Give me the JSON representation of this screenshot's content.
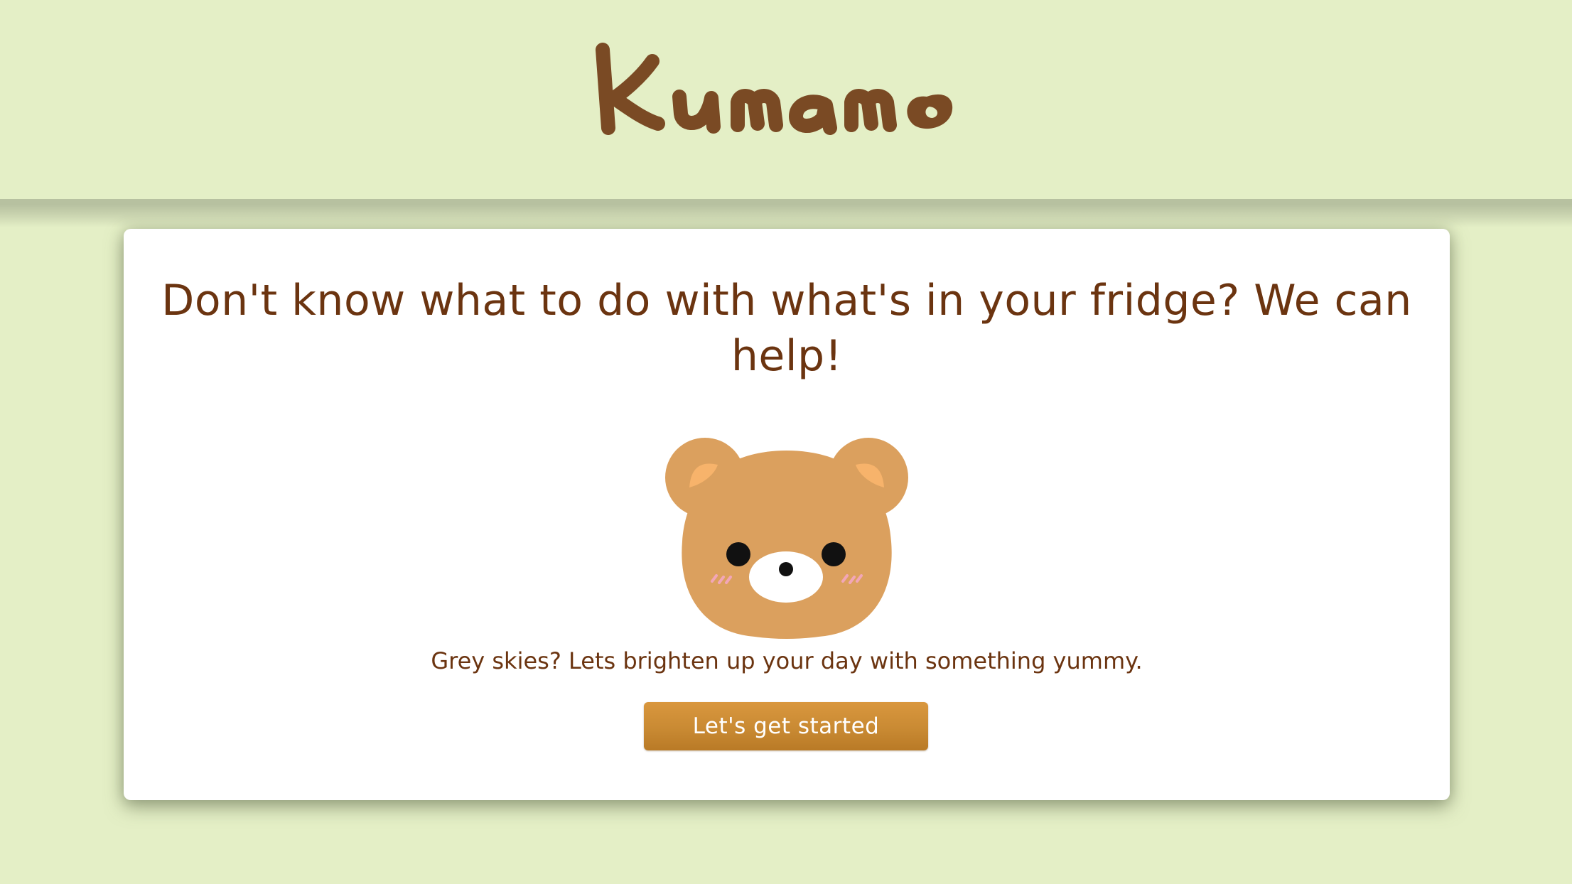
{
  "header": {
    "logo_text": "Kumamo"
  },
  "hero": {
    "headline": "Don't know what to do with what's in your fridge? We can help!",
    "tagline": "Grey skies? Lets brighten up your day with something yummy.",
    "cta_label": "Let's get started",
    "mascot_icon": "bear-face-icon"
  },
  "colors": {
    "background": "#e4efc6",
    "card": "#ffffff",
    "text_brown": "#6b3410",
    "logo_brown": "#7a4a24",
    "button_orange": "#c98a33",
    "bear_fur": "#dba05e",
    "bear_inner_ear": "#f7b36b"
  }
}
